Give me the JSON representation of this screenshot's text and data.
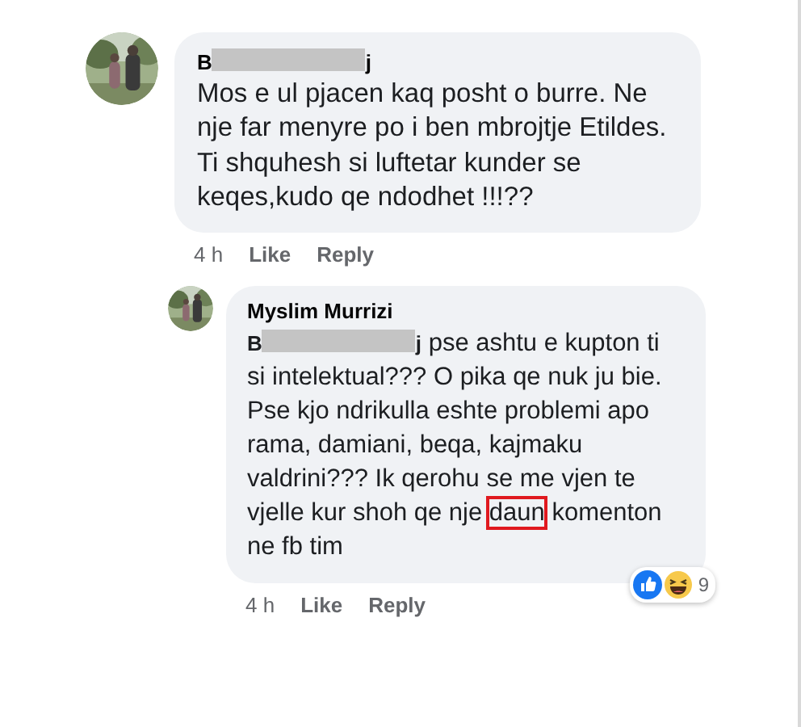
{
  "comments": [
    {
      "kind": "comment",
      "mention_start": "B",
      "mention_end": "j",
      "lines": [
        "Mos e ul pjacen kaq posht o burre. Ne nje far menyre po i ben mbrojtje Etildes.",
        "Ti shquhesh si luftetar kunder se keqes,kudo qe ndodhet !!!??"
      ],
      "time": "4 h",
      "like": "Like",
      "reply": "Reply"
    },
    {
      "kind": "reply",
      "author": "Myslim Murrizi",
      "mention_start": "B",
      "mention_end": "j",
      "text_before": " pse ashtu e kupton ti si intelektual??? O pika qe nuk ju bie. Pse kjo ndrikulla eshte problemi apo rama, damiani, beqa, kajmaku valdrini??? Ik qerohu se me vjen te vjelle kur shoh qe nje ",
      "highlighted": "daun",
      "text_after": " komenton ne fb tim",
      "time": "4 h",
      "like": "Like",
      "reply": "Reply",
      "reaction_count": "9"
    }
  ]
}
